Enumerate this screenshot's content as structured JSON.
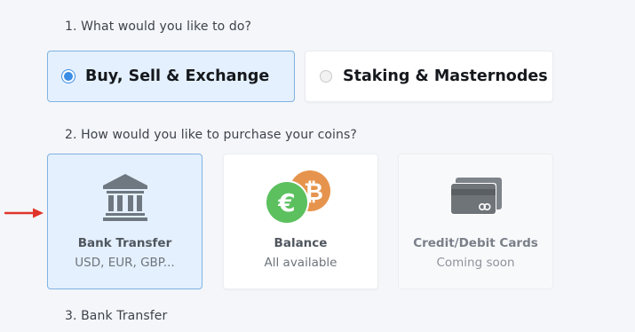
{
  "steps": {
    "step1": "1. What would you like to do?",
    "step2": "2. How would you like to purchase your coins?",
    "step3": "3. Bank Transfer"
  },
  "action_options": [
    {
      "label": "Buy, Sell & Exchange",
      "selected": true
    },
    {
      "label": "Staking & Masternodes",
      "selected": false
    }
  ],
  "payment_methods": [
    {
      "title": "Bank Transfer",
      "subtitle": "USD, EUR, GBP...",
      "icon": "bank-icon",
      "selected": true
    },
    {
      "title": "Balance",
      "subtitle": "All available",
      "icon": "euro-bitcoin-coins-icon",
      "selected": false
    },
    {
      "title": "Credit/Debit Cards",
      "subtitle": "Coming soon",
      "icon": "credit-cards-icon",
      "selected": false
    }
  ],
  "colors": {
    "accent": "#3b8de6",
    "selected_background": "#e4f0fd",
    "selected_border": "#7fb3e4",
    "euro_coin": "#5cc05f",
    "bitcoin_coin": "#e6944d",
    "pointer_arrow": "#e0342a"
  }
}
